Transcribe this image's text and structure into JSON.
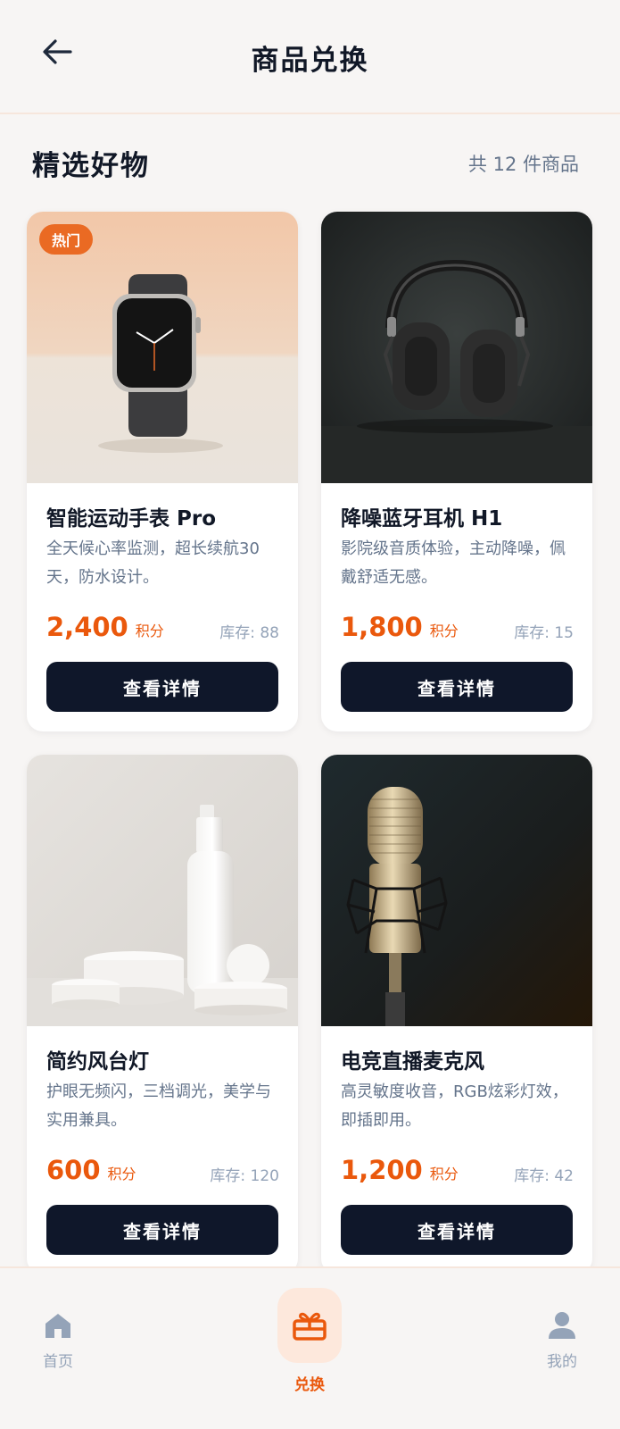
{
  "header": {
    "title": "商品兑换",
    "back_icon": "arrow-left-icon"
  },
  "section": {
    "title": "精选好物",
    "count_text": "共 12 件商品"
  },
  "products": [
    {
      "badge": "热门",
      "name": "智能运动手表 Pro",
      "desc": "全天候心率监测，超长续航30天，防水设计。",
      "price": "2,400",
      "unit": "积分",
      "stock": "库存: 88",
      "button": "查看详情",
      "image": "smartwatch"
    },
    {
      "name": "降噪蓝牙耳机 H1",
      "desc": "影院级音质体验，主动降噪，佩戴舒适无感。",
      "price": "1,800",
      "unit": "积分",
      "stock": "库存: 15",
      "button": "查看详情",
      "image": "headphones"
    },
    {
      "name": "简约风台灯",
      "desc": "护眼无频闪，三档调光，美学与实用兼具。",
      "price": "600",
      "unit": "积分",
      "stock": "库存: 120",
      "button": "查看详情",
      "image": "white-products"
    },
    {
      "name": "电竞直播麦克风",
      "desc": "高灵敏度收音，RGB炫彩灯效，即插即用。",
      "price": "1,200",
      "unit": "积分",
      "stock": "库存: 42",
      "button": "查看详情",
      "image": "microphone"
    }
  ],
  "nav": {
    "home": "首页",
    "exchange": "兑换",
    "mine": "我的"
  },
  "colors": {
    "accent": "#ea580c",
    "button": "#0f172a",
    "muted": "#64748b"
  }
}
